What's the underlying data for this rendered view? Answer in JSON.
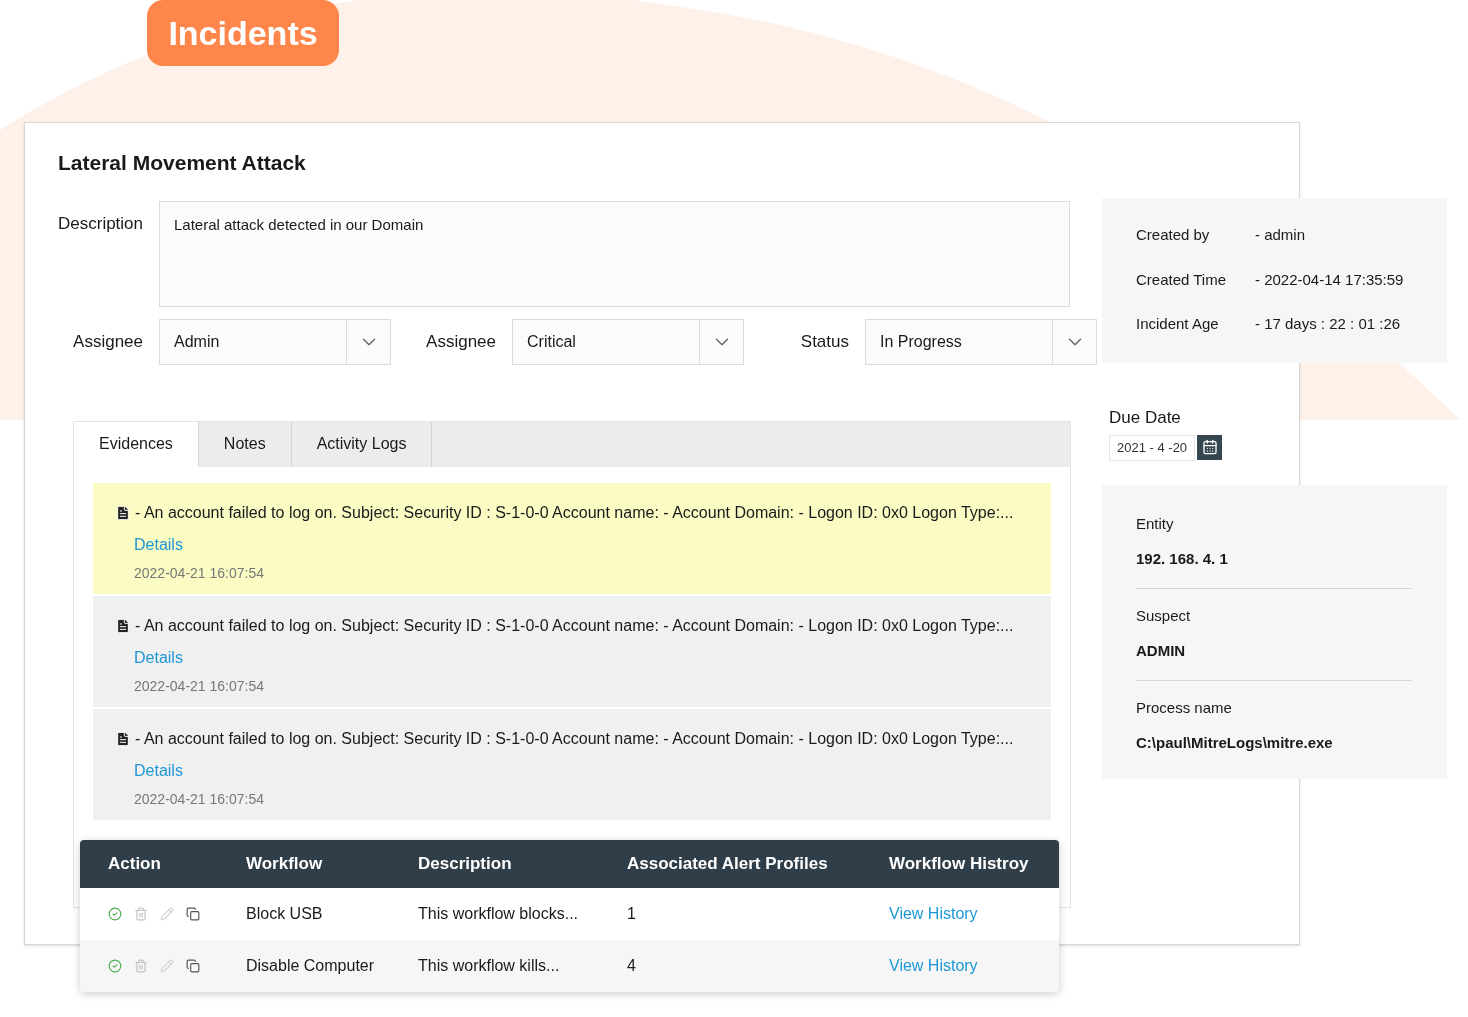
{
  "header": {
    "badge": "Incidents"
  },
  "incident": {
    "title": "Lateral Movement Attack",
    "description_label": "Description",
    "description": "Lateral attack detected in our Domain",
    "selects": [
      {
        "label": "Assignee",
        "value": "Admin"
      },
      {
        "label": "Assignee",
        "value": "Critical"
      },
      {
        "label": "Status",
        "value": "In Progress"
      }
    ]
  },
  "tabs": [
    {
      "label": "Evidences",
      "selected": true
    },
    {
      "label": "Notes",
      "selected": false
    },
    {
      "label": "Activity Logs",
      "selected": false
    }
  ],
  "evidences": [
    {
      "text": "- An account failed to log on. Subject: Security ID : S-1-0-0 Account name: - Account Domain: - Logon ID: 0x0 Logon Type:...",
      "link": "Details",
      "time": "2022-04-21 16:07:54",
      "highlighted": true
    },
    {
      "text": "- An account failed to log on. Subject: Security ID : S-1-0-0 Account name: - Account Domain: - Logon ID: 0x0 Logon Type:...",
      "link": "Details",
      "time": "2022-04-21 16:07:54",
      "highlighted": false
    },
    {
      "text": "- An account failed to log on. Subject: Security ID : S-1-0-0 Account name: - Account Domain: - Logon ID: 0x0 Logon Type:...",
      "link": "Details",
      "time": "2022-04-21 16:07:54",
      "highlighted": false
    }
  ],
  "info": [
    {
      "label": "Created by",
      "value": "- admin"
    },
    {
      "label": "Created Time",
      "value": "- 2022-04-14 17:35:59"
    },
    {
      "label": "Incident Age",
      "value": "- 17 days : 22 : 01 :26"
    }
  ],
  "due_date": {
    "label": "Due Date",
    "value": "2021 - 4 -20"
  },
  "entity_panel": [
    {
      "label": "Entity",
      "value": "192. 168. 4. 1"
    },
    {
      "label": "Suspect",
      "value": "ADMIN"
    },
    {
      "label": "Process name",
      "value": "C:\\paul\\MitreLogs\\mitre.exe"
    }
  ],
  "workflow_table": {
    "columns": [
      "Action",
      "Workflow",
      "Description",
      "Associated Alert Profiles",
      "Workflow Histroy"
    ],
    "rows": [
      {
        "workflow": "Block USB",
        "description": "This workflow blocks...",
        "alert_profiles": "1",
        "history": "View History"
      },
      {
        "workflow": "Disable Computer",
        "description": "This workflow kills...",
        "alert_profiles": "4",
        "history": "View History"
      }
    ]
  }
}
